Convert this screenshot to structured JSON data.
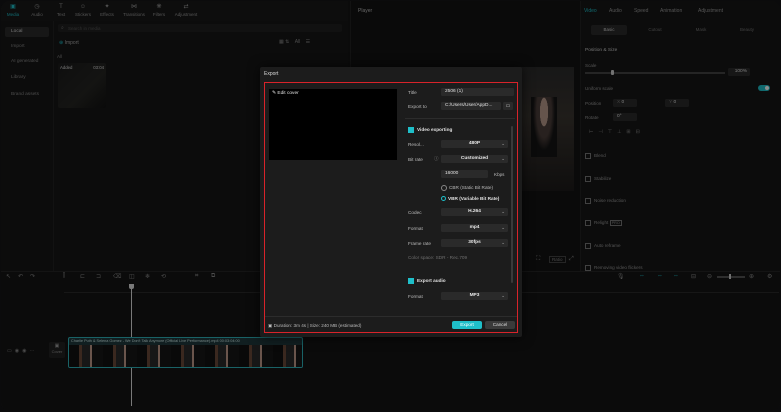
{
  "toolbar": {
    "items": [
      {
        "label": "Media",
        "icon": "media-icon"
      },
      {
        "label": "Audio",
        "icon": "audio-icon"
      },
      {
        "label": "Text",
        "icon": "text-icon"
      },
      {
        "label": "Stickers",
        "icon": "stickers-icon"
      },
      {
        "label": "Effects",
        "icon": "effects-icon"
      },
      {
        "label": "Transitions",
        "icon": "transitions-icon"
      },
      {
        "label": "Filters",
        "icon": "filters-icon"
      },
      {
        "label": "Adjustment",
        "icon": "adjustment-icon"
      }
    ]
  },
  "sidebar": {
    "items": [
      {
        "label": "Local"
      },
      {
        "label": "Import"
      },
      {
        "label": "AI generated"
      },
      {
        "label": "Library"
      },
      {
        "label": "Brand assets"
      }
    ]
  },
  "media": {
    "search_placeholder": "Search in media",
    "import_label": "Import",
    "filter_label": "All",
    "thumb_added": "Added",
    "thumb_duration": "03:04"
  },
  "player": {
    "title": "Player",
    "ratio_label": "Ratio"
  },
  "inspector": {
    "tabs": [
      {
        "label": "Video"
      },
      {
        "label": "Audio"
      },
      {
        "label": "Speed"
      },
      {
        "label": "Animation"
      },
      {
        "label": "Adjustment"
      }
    ],
    "subtabs": [
      {
        "label": "Basic"
      },
      {
        "label": "Cutout"
      },
      {
        "label": "Mask"
      },
      {
        "label": "Beauty"
      }
    ],
    "position_size": "Position & Size",
    "scale_label": "Scale",
    "scale_value": "100%",
    "uniform_scale": "Uniform scale",
    "position_label": "Position",
    "position_x": "0",
    "position_y": "0",
    "rotate_label": "Rotate",
    "rotate_value": "0°",
    "blend": "Blend",
    "stabilize": "Stabilize",
    "noise": "Noise reduction",
    "relight": "Relight",
    "relight_badge": "PRO",
    "auto_reframe": "Auto reframe",
    "remove_flicker": "Removing video flickers",
    "footer_left": "Cancel",
    "footer_right": "Apply to all"
  },
  "timeline": {
    "cover_label": "Cover",
    "clip_title": "Charlie Puth & Selena Gomez - We Don't Talk Anymore (Official Live Performance).mp4  00:03:04:00"
  },
  "export": {
    "title": "Export",
    "edit_cover": "Edit cover",
    "title_label": "Title",
    "title_value": "2506 (1)",
    "export_to_label": "Export to",
    "export_to_value": "C:/Users/User/AppD...",
    "video_exporting": "Video exporting",
    "resolution_label": "Resol...",
    "resolution_value": "480P",
    "bitrate_label": "Bit rate",
    "bitrate_value": "Customized",
    "bitrate_num": "16000",
    "bitrate_unit": "Kbps",
    "cbr": "CBR (Static Bit Rate)",
    "vbr": "VBR (Variable Bit Rate)",
    "codec_label": "Codec",
    "codec_value": "H.264",
    "format_label": "Format",
    "format_value": "mp4",
    "framerate_label": "Frame rate",
    "framerate_value": "30fps",
    "colorspace": "Color space: SDR - Rec.709",
    "export_audio": "Export audio",
    "audio_format_label": "Format",
    "audio_format_value": "MP3",
    "footer_info": "Duration: 3m 4s | Size: 240 MB (estimated)",
    "export_button": "Export",
    "cancel_button": "Cancel"
  },
  "colors": {
    "accent": "#1fbfc9",
    "highlight_border": "#d8232a"
  }
}
